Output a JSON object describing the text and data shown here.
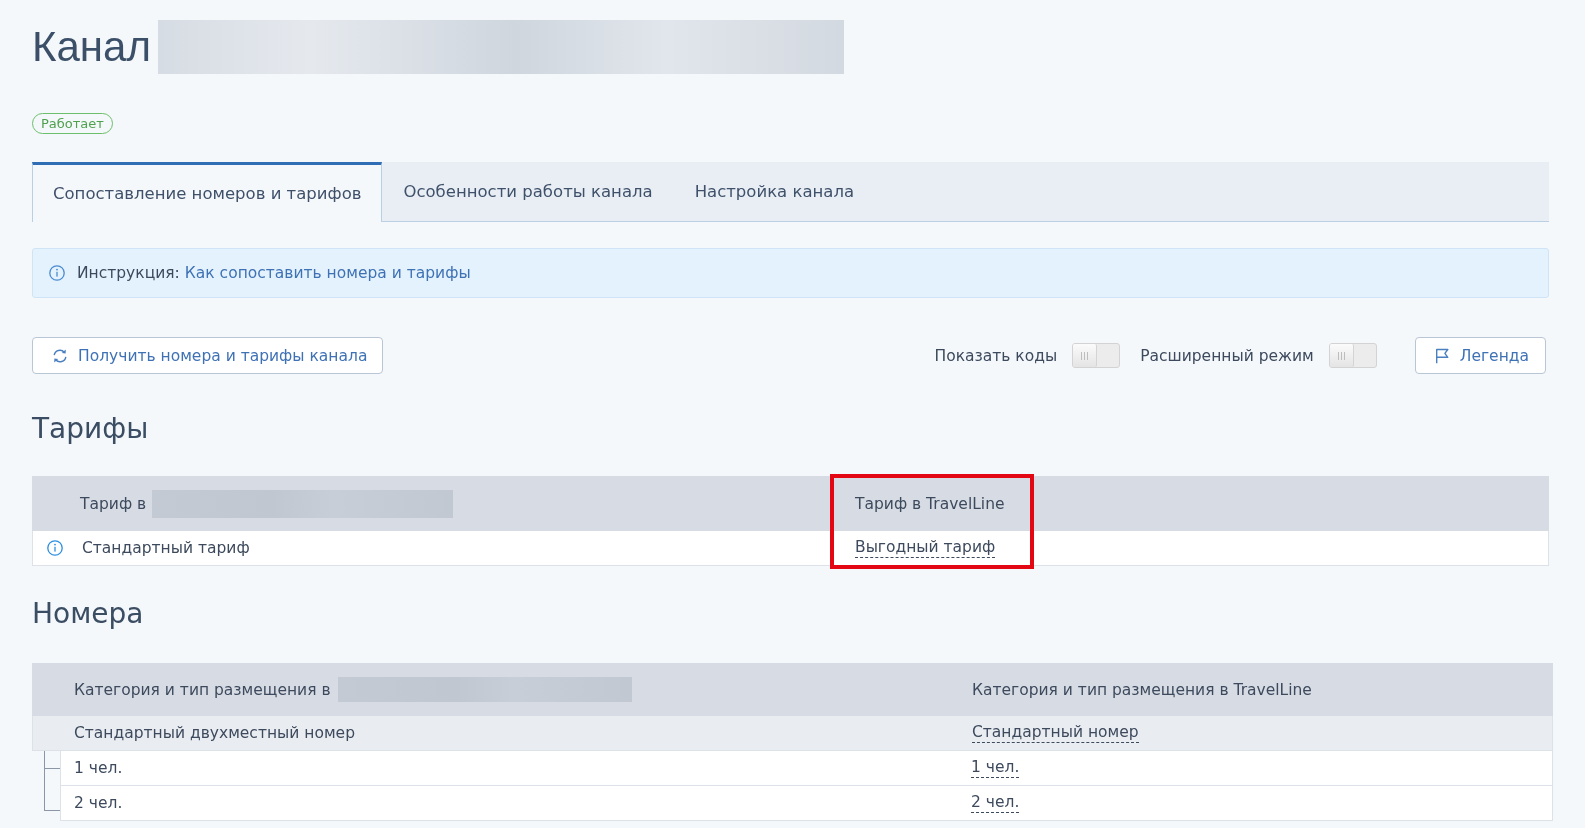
{
  "page": {
    "title": "Канал",
    "title_redacted": true,
    "status": "Работает"
  },
  "tabs": [
    {
      "label": "Сопоставление номеров и тарифов",
      "selected": true
    },
    {
      "label": "Особенности работы канала",
      "selected": false
    },
    {
      "label": "Настройка канала",
      "selected": false
    }
  ],
  "instruction": {
    "label": "Инструкция:",
    "link": "Как сопоставить номера и тарифы"
  },
  "fetch_button": "Получить номера и тарифы канала",
  "toggles": [
    {
      "label": "Показать коды",
      "on": false
    },
    {
      "label": "Расширенный режим",
      "on": false
    }
  ],
  "legend_button": "Легенда",
  "rates": {
    "heading": "Тарифы",
    "columns": [
      {
        "label": "Тариф в",
        "redacted": true,
        "highlighted": false
      },
      {
        "label": "Тариф в TravelLine",
        "redacted": false,
        "highlighted": true
      }
    ],
    "rows": [
      {
        "channel_rate": "Стандартный тариф",
        "travelline_rate": "Выгодный тариф"
      }
    ]
  },
  "rooms": {
    "heading": "Номера",
    "columns": [
      {
        "label": "Категория и тип размещения в",
        "redacted": true
      },
      {
        "label": "Категория и тип размещения в TravelLine",
        "redacted": false
      }
    ],
    "rows": [
      {
        "channel_room": "Стандартный двухместный номер",
        "travelline_room": "Стандартный номер",
        "children": [
          {
            "channel_room": "1 чел.",
            "travelline_room": "1 чел."
          },
          {
            "channel_room": "2 чел.",
            "travelline_room": "2 чел."
          }
        ]
      }
    ]
  }
}
